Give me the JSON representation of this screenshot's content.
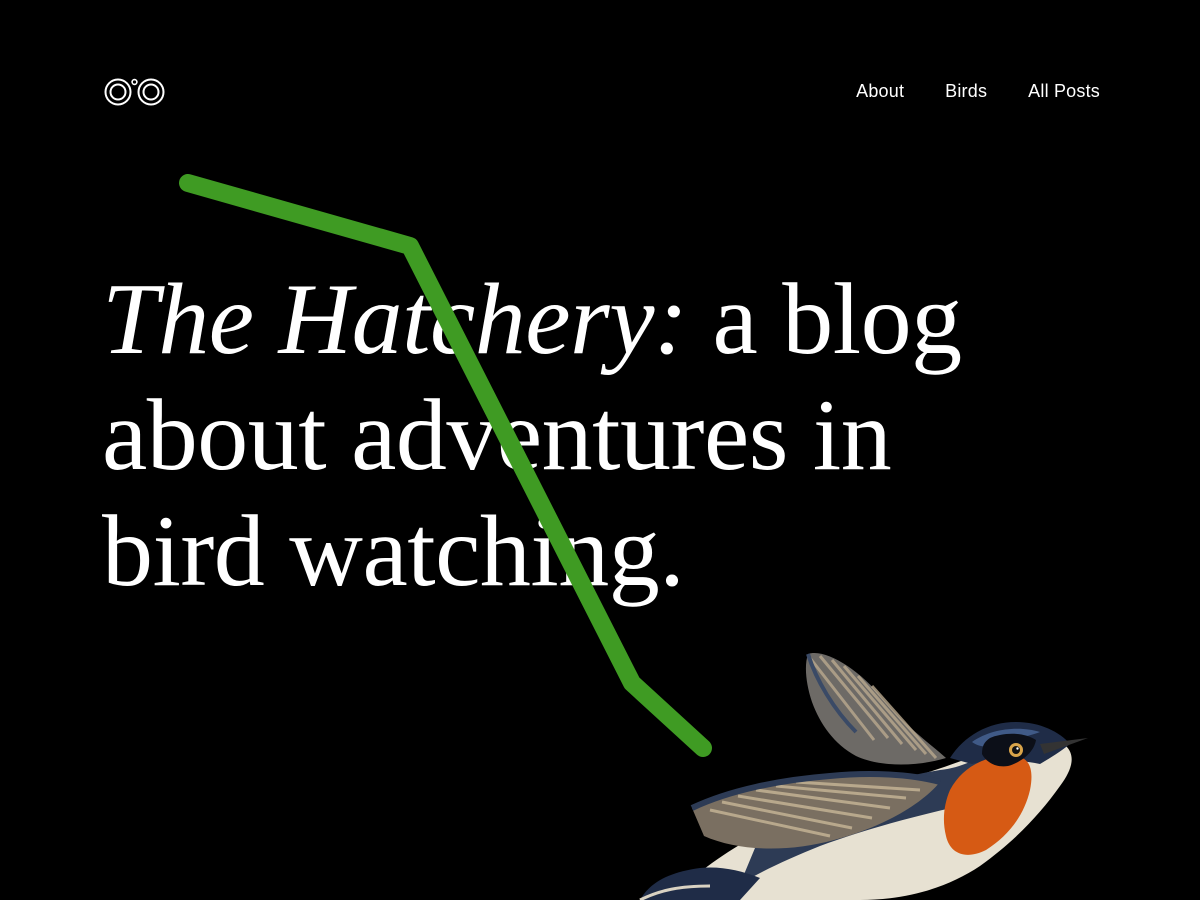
{
  "header": {
    "logo_icon": "binoculars-icon",
    "nav": [
      {
        "label": "About"
      },
      {
        "label": "Birds"
      },
      {
        "label": "All Posts"
      }
    ]
  },
  "hero": {
    "title_italic": "The Hatchery:",
    "title_rest": " a blog about adventures in bird watching."
  },
  "decor": {
    "line_color": "#3f9b23",
    "bird_icon": "bird-illustration"
  }
}
